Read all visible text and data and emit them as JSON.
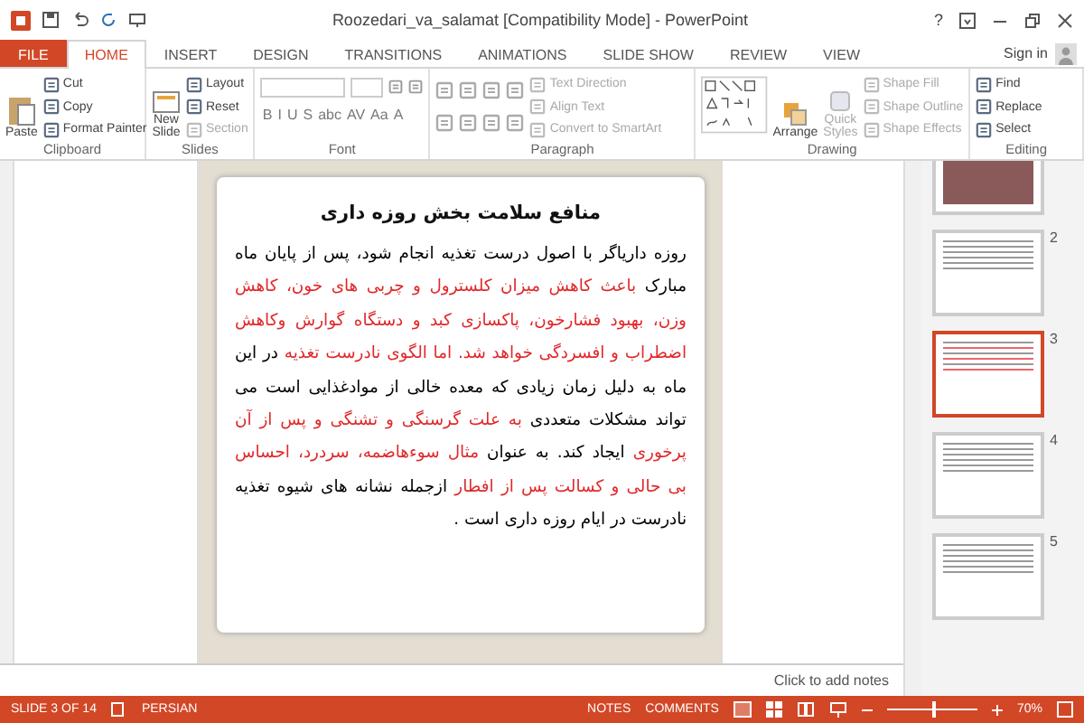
{
  "window": {
    "title": "Roozedari_va_salamat [Compatibility Mode] - PowerPoint",
    "help": "?",
    "sign_in": "Sign in"
  },
  "tabs": [
    {
      "label": "FILE",
      "kind": "file",
      "selected": false
    },
    {
      "label": "HOME",
      "kind": "tab",
      "selected": true
    },
    {
      "label": "INSERT",
      "kind": "tab",
      "selected": false
    },
    {
      "label": "DESIGN",
      "kind": "tab",
      "selected": false
    },
    {
      "label": "TRANSITIONS",
      "kind": "tab",
      "selected": false
    },
    {
      "label": "ANIMATIONS",
      "kind": "tab",
      "selected": false
    },
    {
      "label": "SLIDE SHOW",
      "kind": "tab",
      "selected": false
    },
    {
      "label": "REVIEW",
      "kind": "tab",
      "selected": false
    },
    {
      "label": "VIEW",
      "kind": "tab",
      "selected": false
    }
  ],
  "ribbon": {
    "clipboard": {
      "label": "Clipboard",
      "paste": "Paste",
      "items": [
        {
          "label": "Cut",
          "disabled": false
        },
        {
          "label": "Copy",
          "disabled": false
        },
        {
          "label": "Format Painter",
          "disabled": false
        }
      ]
    },
    "slides": {
      "label": "Slides",
      "new_slide": [
        "New",
        "Slide"
      ],
      "items": [
        {
          "label": "Layout",
          "disabled": false
        },
        {
          "label": "Reset",
          "disabled": false
        },
        {
          "label": "Section",
          "disabled": true
        }
      ]
    },
    "font": {
      "label": "Font",
      "buttons": [
        "B",
        "I",
        "U",
        "S",
        "abc",
        "AV",
        "Aa",
        "A"
      ]
    },
    "paragraph": {
      "label": "Paragraph",
      "items": [
        {
          "label": "Text Direction",
          "disabled": true
        },
        {
          "label": "Align Text",
          "disabled": true
        },
        {
          "label": "Convert to SmartArt",
          "disabled": true
        }
      ]
    },
    "drawing": {
      "label": "Drawing",
      "arrange": "Arrange",
      "quick_styles": [
        "Quick",
        "Styles"
      ],
      "items": [
        {
          "label": "Shape Fill",
          "disabled": true
        },
        {
          "label": "Shape Outline",
          "disabled": true
        },
        {
          "label": "Shape Effects",
          "disabled": true
        }
      ]
    },
    "editing": {
      "label": "Editing",
      "items": [
        {
          "label": "Find",
          "disabled": false
        },
        {
          "label": "Replace",
          "disabled": false
        },
        {
          "label": "Select",
          "disabled": false
        }
      ]
    }
  },
  "slide": {
    "title": "منافع سلامت بخش روزه داری",
    "segments": [
      {
        "text": "روزه داریاگر با اصول درست تغذیه انجام شود، پس از پایان ماه مبارک ",
        "color": "#000000"
      },
      {
        "text": "باعث کاهش میزان کلسترول و چربی های خون، کاهش وزن، بهبود فشارخون، پاکسازی کبد و دستگاه گوارش وکاهش اضطراب و افسردگی خواهد شد. اما الگوی نادرست تغذیه",
        "color": "#e0282a"
      },
      {
        "text": " در این ماه به دلیل زمان زیادی که معده خالی از موادغذایی است می تواند مشکلات متعددی ",
        "color": "#000000"
      },
      {
        "text": "به علت گرسنگی و تشنگی و پس از آن پرخوری",
        "color": "#e0282a"
      },
      {
        "text": " ایجاد کند. به عنوان ",
        "color": "#000000"
      },
      {
        "text": "مثال سوءهاضمه، سردرد، احساس بی حالی و کسالت پس از افطار",
        "color": "#e0282a"
      },
      {
        "text": " ازجمله نشانه های شیوه تغذیه نادرست در ایام روزه داری است .",
        "color": "#000000"
      }
    ]
  },
  "notes": {
    "placeholder": "Click to add notes"
  },
  "thumbnails": [
    {
      "kind": "photo",
      "selected": false
    },
    {
      "number": "2",
      "kind": "text",
      "selected": false
    },
    {
      "number": "3",
      "kind": "text",
      "selected": true
    },
    {
      "number": "4",
      "kind": "text",
      "selected": false
    },
    {
      "number": "5",
      "kind": "text",
      "selected": false
    }
  ],
  "status_bar": {
    "slide": "SLIDE 3 OF 14",
    "language": "PERSIAN",
    "notes": "NOTES",
    "comments": "COMMENTS",
    "zoom": "70%",
    "zoom_slider": {
      "level": 0.5
    }
  }
}
